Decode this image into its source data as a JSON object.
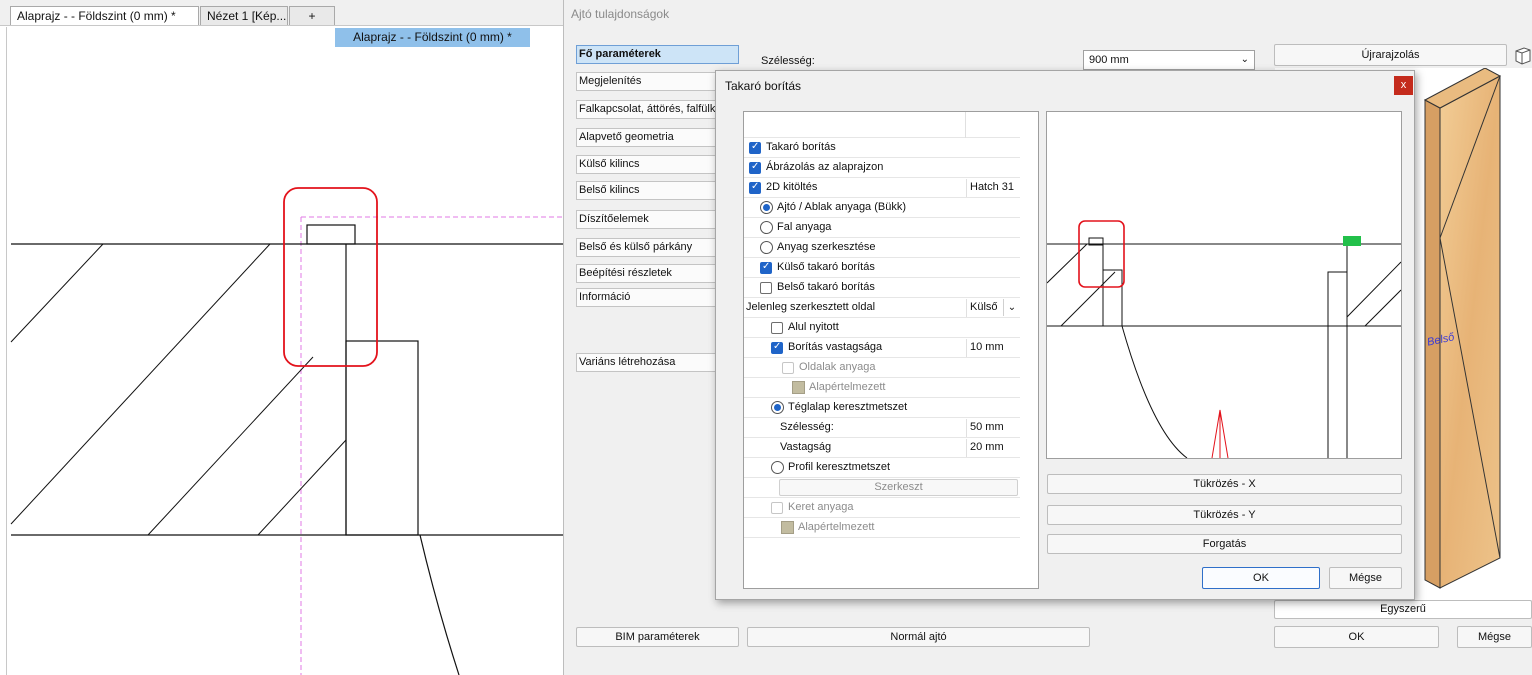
{
  "tabs": [
    {
      "label": "Alaprajz -  - Földszint (0 mm) *",
      "active": true
    },
    {
      "label": "Nézet 1 [Kép...",
      "active": false
    },
    {
      "label": "+",
      "active": false
    }
  ],
  "view_label": "Alaprajz -  - Földszint (0 mm) *",
  "properties": {
    "title": "Ajtó tulajdonságok",
    "nav": [
      {
        "label": "Fő paraméterek",
        "selected": true
      },
      {
        "label": "Megjelenítés"
      },
      {
        "label": "Falkapcsolat, áttörés, falfülke"
      },
      {
        "label": "Alapvető geometria"
      },
      {
        "label": "Külső kilincs"
      },
      {
        "label": "Belső kilincs"
      },
      {
        "label": "Díszítőelemek"
      },
      {
        "label": "Belső és külső párkány"
      },
      {
        "label": "Beépítési részletek"
      },
      {
        "label": "Információ"
      },
      {
        "label": "Variáns létrehozása"
      }
    ],
    "width_label": "Szélesség:",
    "width_value": "900 mm",
    "redraw_button": "Újrarajzolás",
    "preview_label": "Belső",
    "simple_button": "Egyszerű",
    "bim_button": "BIM paraméterek",
    "normal_door_button": "Normál ajtó",
    "ok_button": "OK",
    "cancel_button": "Mégse"
  },
  "cover": {
    "title": "Takaró borítás",
    "close": "x",
    "rows": [
      {
        "type": "checkbox",
        "checked": true,
        "label": "Takaró borítás",
        "indent": 0
      },
      {
        "type": "checkbox",
        "checked": true,
        "label": "Ábrázolás az alaprajzon",
        "indent": 0
      },
      {
        "type": "checkbox",
        "checked": true,
        "label": "2D kitöltés",
        "indent": 0,
        "value": "Hatch 31"
      },
      {
        "type": "radio",
        "checked": true,
        "label": "Ajtó / Ablak anyaga (Bükk)",
        "indent": 1
      },
      {
        "type": "radio",
        "checked": false,
        "label": "Fal anyaga",
        "indent": 1
      },
      {
        "type": "radio",
        "checked": false,
        "label": "Anyag szerkesztése",
        "indent": 1
      },
      {
        "type": "checkbox",
        "checked": true,
        "label": "Külső takaró borítás",
        "indent": 1
      },
      {
        "type": "checkbox",
        "checked": false,
        "label": "Belső takaró borítás",
        "indent": 1
      },
      {
        "type": "combo",
        "label": "Jelenleg szerkesztett oldal",
        "indent": 0,
        "value": "Külső"
      },
      {
        "type": "checkbox",
        "checked": false,
        "label": "Alul nyitott",
        "indent": 2
      },
      {
        "type": "checkbox",
        "checked": true,
        "label": "Borítás vastagsága",
        "indent": 2,
        "value": "10 mm"
      },
      {
        "type": "checkbox",
        "checked": false,
        "disabled": true,
        "label": "Oldalak anyaga",
        "indent": 3
      },
      {
        "type": "swatch",
        "disabled": true,
        "label": "Alapértelmezett",
        "indent": 4
      },
      {
        "type": "radio",
        "checked": true,
        "label": "Téglalap keresztmetszet",
        "indent": 2
      },
      {
        "type": "text",
        "label": "Szélesség:",
        "indent": 2,
        "value": "50 mm"
      },
      {
        "type": "text",
        "label": "Vastagság",
        "indent": 2,
        "value": "20 mm"
      },
      {
        "type": "radio",
        "checked": false,
        "label": "Profil keresztmetszet",
        "indent": 2
      },
      {
        "type": "button",
        "label": "Szerkeszt",
        "indent": 2
      },
      {
        "type": "checkbox",
        "checked": false,
        "disabled": true,
        "label": "Keret anyaga",
        "indent": 2
      },
      {
        "type": "swatch",
        "disabled": true,
        "label": "Alapértelmezett",
        "indent": 3
      }
    ],
    "mirror_x": "Tükrözés - X",
    "mirror_y": "Tükrözés - Y",
    "rotate": "Forgatás",
    "ok": "OK",
    "cancel": "Mégse"
  }
}
